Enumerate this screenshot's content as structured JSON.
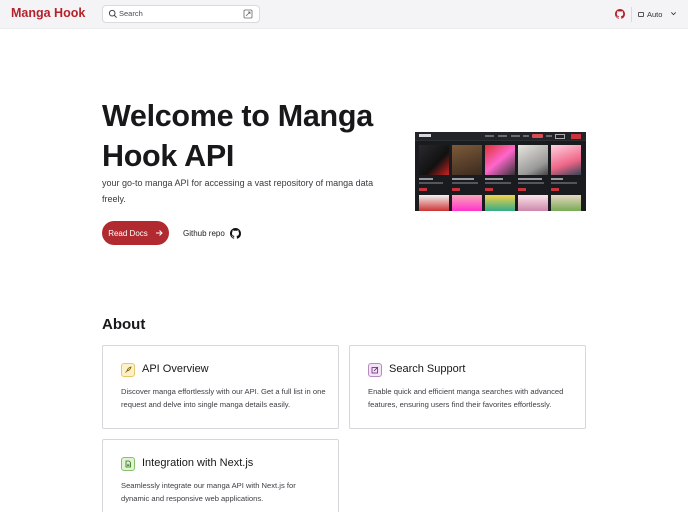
{
  "header": {
    "brand": "Manga Hook",
    "search_placeholder": "Search",
    "theme_label": "Auto"
  },
  "hero": {
    "title": "Welcome to Manga Hook API",
    "subtitle": "your go-to manga API for accessing a vast repository of manga data freely.",
    "primary_button": "Read Docs",
    "secondary_link": "Github repo"
  },
  "about": {
    "heading": "About",
    "cards": [
      {
        "title": "API Overview",
        "description": "Discover manga effortlessly with our API. Get a full list in one request and delve into single manga details easily.",
        "icon": "rocket-icon"
      },
      {
        "title": "Search Support",
        "description": "Enable quick and efficient manga searches with advanced features, ensuring users find their favorites effortlessly.",
        "icon": "edit-icon"
      },
      {
        "title": "Integration with Next.js",
        "description": "Seamlessly integrate our manga API with Next.js for dynamic and responsive web applications.",
        "icon": "document-icon"
      }
    ]
  },
  "colors": {
    "brand": "#b4232b",
    "primary_button": "#b02a30",
    "card_icon_1_bg": "#fdf1c9",
    "card_icon_2_bg": "#f3e3f7",
    "card_icon_3_bg": "#e1f3d6"
  }
}
